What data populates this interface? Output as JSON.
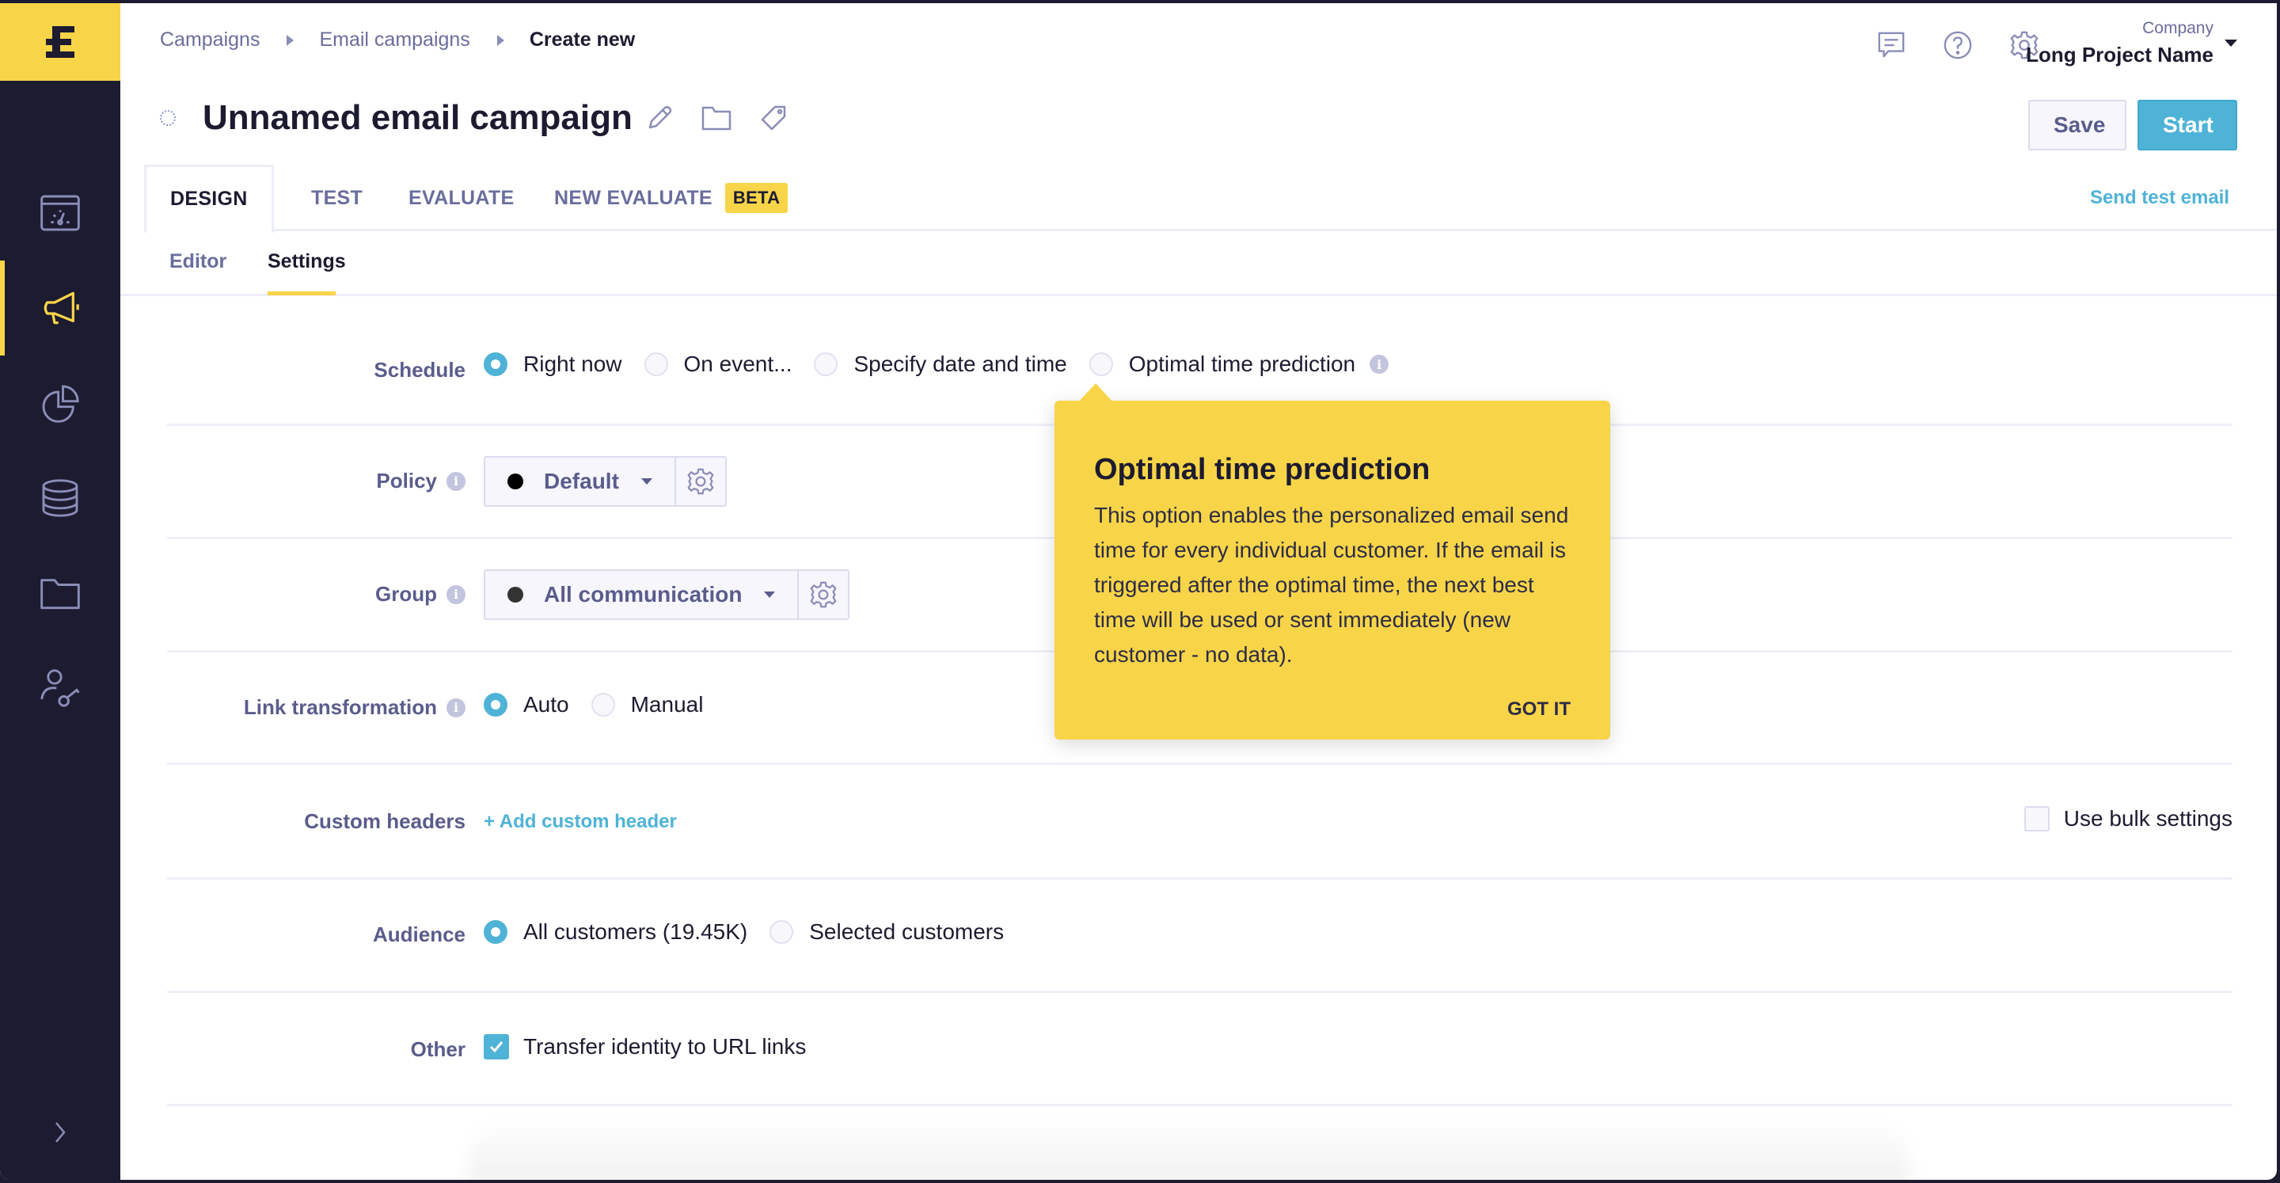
{
  "colors": {
    "brand_yellow": "#f8d448",
    "sidebar_bg": "#1c1b30",
    "accent_blue": "#4eb3d6",
    "muted_text": "#6a6d9c"
  },
  "sidebar": {
    "logo_icon": "exponea-logo-icon",
    "items": [
      {
        "icon": "dashboard-icon",
        "label": "Dashboards",
        "active": false
      },
      {
        "icon": "megaphone-icon",
        "label": "Campaigns",
        "active": true
      },
      {
        "icon": "pie-chart-icon",
        "label": "Analyses",
        "active": false
      },
      {
        "icon": "database-icon",
        "label": "Data & Assets",
        "active": false
      },
      {
        "icon": "folder-icon",
        "label": "Files",
        "active": false
      },
      {
        "icon": "user-key-icon",
        "label": "Access",
        "active": false
      }
    ],
    "expand_icon": "chevron-right-icon"
  },
  "header": {
    "breadcrumb": [
      "Campaigns",
      "Email campaigns",
      "Create new"
    ],
    "icons": [
      "chat-icon",
      "help-icon",
      "settings-icon"
    ],
    "project": {
      "company_label": "Company",
      "name": "Long Project Name"
    }
  },
  "title": {
    "text": "Unnamed email campaign",
    "icons": [
      "pencil-icon",
      "folder-icon",
      "tag-icon"
    ]
  },
  "actions": {
    "save_label": "Save",
    "start_label": "Start"
  },
  "tabs": {
    "items": [
      {
        "label": "DESIGN",
        "active": true
      },
      {
        "label": "TEST",
        "active": false
      },
      {
        "label": "EVALUATE",
        "active": false
      },
      {
        "label": "NEW EVALUATE",
        "active": false,
        "badge": "BETA"
      }
    ],
    "send_test_label": "Send test email"
  },
  "subtabs": {
    "items": [
      {
        "label": "Editor",
        "active": false
      },
      {
        "label": "Settings",
        "active": true
      }
    ]
  },
  "settings": {
    "schedule": {
      "label": "Schedule",
      "options": [
        "Right now",
        "On event...",
        "Specify date and time",
        "Optimal time prediction"
      ],
      "selected": "Right now"
    },
    "policy": {
      "label": "Policy",
      "value": "Default"
    },
    "group": {
      "label": "Group",
      "value": "All communication"
    },
    "link_transformation": {
      "label": "Link transformation",
      "options": [
        "Auto",
        "Manual"
      ],
      "selected": "Auto"
    },
    "custom_headers": {
      "label": "Custom headers",
      "add_label": "+ Add custom header",
      "bulk_label": "Use bulk settings",
      "bulk_checked": false
    },
    "audience": {
      "label": "Audience",
      "options": [
        "All customers (19.45K)",
        "Selected customers"
      ],
      "selected": "All customers (19.45K)"
    },
    "other": {
      "label": "Other",
      "checkbox_label": "Transfer identity to URL links",
      "checked": true
    }
  },
  "popover": {
    "title": "Optimal time prediction",
    "body": "This option enables the personalized email send time for every individual customer. If the email is triggered after the optimal time, the next best time will be used or sent immediately (new customer - no data).",
    "button": "GOT IT"
  }
}
